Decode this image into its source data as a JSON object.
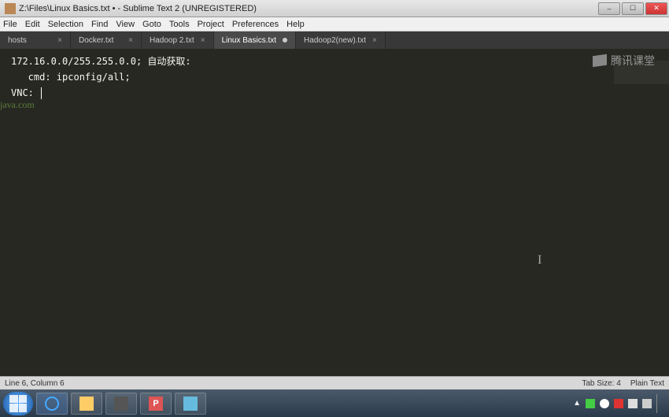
{
  "window": {
    "title": "Z:\\Files\\Linux Basics.txt • - Sublime Text 2 (UNREGISTERED)",
    "controls": {
      "min": "–",
      "max": "☐",
      "close": "✕"
    }
  },
  "menu": [
    "File",
    "Edit",
    "Selection",
    "Find",
    "View",
    "Goto",
    "Tools",
    "Project",
    "Preferences",
    "Help"
  ],
  "tabs": [
    {
      "label": "hosts",
      "active": false,
      "modified": false
    },
    {
      "label": "Docker.txt",
      "active": false,
      "modified": false
    },
    {
      "label": "Hadoop 2.txt",
      "active": false,
      "modified": false
    },
    {
      "label": "Linux Basics.txt",
      "active": true,
      "modified": true
    },
    {
      "label": "Hadoop2(new).txt",
      "active": false,
      "modified": false
    }
  ],
  "editor": {
    "lines": [
      "172.16.0.0/255.255.0.0; 自动获取:",
      "",
      "   cmd: ipconfig/all;",
      "",
      "VNC: "
    ],
    "watermark_right": "腾讯课堂",
    "watermark_left": "java.com"
  },
  "statusbar": {
    "left": "Line 6, Column 6",
    "tab_size": "Tab Size: 4",
    "syntax": "Plain Text"
  },
  "taskbar": {
    "tray_sep": "▲"
  }
}
